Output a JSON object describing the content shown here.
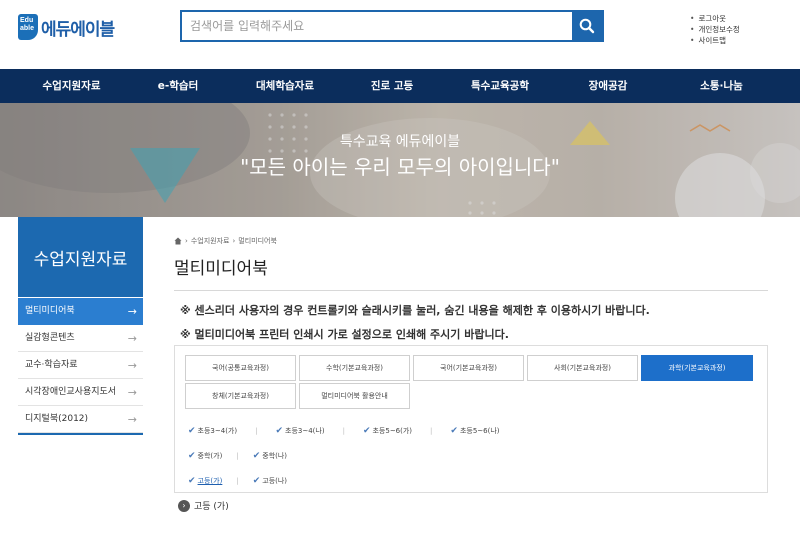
{
  "header": {
    "logo_mark": "Edu able",
    "logo_text": "에듀에이블",
    "search_placeholder": "검색어를 입력해주세요",
    "util_links": [
      "로그아웃",
      "개인정보수정",
      "사이트맵"
    ]
  },
  "gnb": [
    "수업지원자료",
    "e-학습터",
    "대체학습자료",
    "진로 고등",
    "특수교육공학",
    "장애공감",
    "소통·나눔"
  ],
  "banner": {
    "subtitle": "특수교육 에듀에이블",
    "title": "\"모든 아이는 우리 모두의 아이입니다\""
  },
  "lnb": {
    "title": "수업지원자료",
    "items": [
      {
        "label": "멀티미디어북",
        "active": true
      },
      {
        "label": "실감형콘텐츠",
        "active": false
      },
      {
        "label": "교수·학습자료",
        "active": false
      },
      {
        "label": "시각장애인교사용지도서",
        "active": false
      },
      {
        "label": "디지털북(2012)",
        "active": false
      }
    ]
  },
  "content": {
    "breadcrumb": [
      "수업지원자료",
      "멀티미디어북"
    ],
    "title": "멀티미디어북",
    "notices": [
      "※ 센스리더 사용자의 경우 컨트롤키와 슬래시키를 눌러, 숨긴 내용을 해제한 후 이용하시기 바랍니다.",
      "※ 멀티미디어북 프린터 인쇄시 가로 설정으로 인쇄해 주시기 바랍니다."
    ],
    "tabs": [
      {
        "label": "국어(공통교육과정)",
        "active": false
      },
      {
        "label": "수학(기본교육과정)",
        "active": false
      },
      {
        "label": "국어(기본교육과정)",
        "active": false
      },
      {
        "label": "사회(기본교육과정)",
        "active": false
      },
      {
        "label": "과학(기본교육과정)",
        "active": true
      },
      {
        "label": "창체(기본교육과정)",
        "active": false
      },
      {
        "label": "멀티미디어북 활용안내",
        "active": false
      }
    ],
    "sub_rows": [
      [
        "초등3~4(가)",
        "초등3~4(나)",
        "초등5~6(가)",
        "초등5~6(나)"
      ],
      [
        "중학(가)",
        "중학(나)"
      ],
      [
        "고등(가)",
        "고등(나)"
      ]
    ],
    "active_sub": "고등(가)",
    "result_label": "고등 (가)"
  },
  "colors": {
    "primary": "#1c69b0",
    "nav_bg": "#0b2d5c",
    "active_tab": "#1d6fca"
  }
}
